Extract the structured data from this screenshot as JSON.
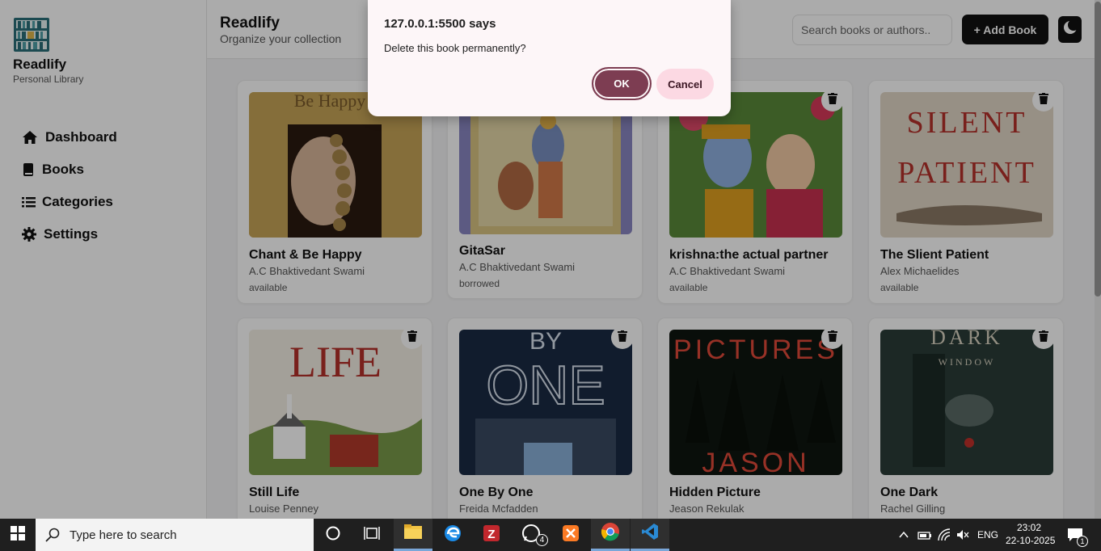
{
  "brand": {
    "name": "Readlify",
    "subtitle": "Personal Library"
  },
  "nav": [
    {
      "label": "Dashboard",
      "icon": "home-icon"
    },
    {
      "label": "Books",
      "icon": "book-icon"
    },
    {
      "label": "Categories",
      "icon": "list-icon"
    },
    {
      "label": "Settings",
      "icon": "gear-icon"
    }
  ],
  "header": {
    "title": "Readlify",
    "subtitle": "Organize your collection",
    "search_placeholder": "Search books or authors..",
    "add_label": "+ Add Book"
  },
  "books": [
    {
      "title": "Chant & Be Happy",
      "author": "A.C Bhaktivedant Swami",
      "status": "available",
      "cover_text": "Be Happy"
    },
    {
      "title": "GitaSar",
      "author": "A.C Bhaktivedant Swami",
      "status": "borrowed",
      "cover_text": ""
    },
    {
      "title": "krishna:the actual partner",
      "author": "A.C Bhaktivedant Swami",
      "status": "available",
      "cover_text": ""
    },
    {
      "title": "The Slient Patient",
      "author": "Alex Michaelides",
      "status": "available",
      "cover_text": "SILENT PATIENT"
    },
    {
      "title": "Still Life",
      "author": "Louise Penney",
      "status": "",
      "cover_text": "LIFE"
    },
    {
      "title": "One By One",
      "author": "Freida Mcfadden",
      "status": "",
      "cover_text": "BY ONE"
    },
    {
      "title": "Hidden Picture",
      "author": "Jeason Rekulak",
      "status": "",
      "cover_text": "PICTURES JASON"
    },
    {
      "title": "One Dark",
      "author": "Rachel Gilling",
      "status": "",
      "cover_text": "DARK WINDOW"
    }
  ],
  "dialog": {
    "origin": "127.0.0.1:5500 says",
    "message": "Delete this book permanently?",
    "ok": "OK",
    "cancel": "Cancel"
  },
  "taskbar": {
    "search_placeholder": "Type here to search",
    "whatsapp_badge": "4",
    "lang": "ENG",
    "time": "23:02",
    "date": "22-10-2025",
    "notif_count": "1"
  },
  "colors": {
    "ok_button": "#7d3d52",
    "cancel_button": "#fcd9e3",
    "dialog_bg": "#fdf6f8",
    "primary": "#111111"
  }
}
